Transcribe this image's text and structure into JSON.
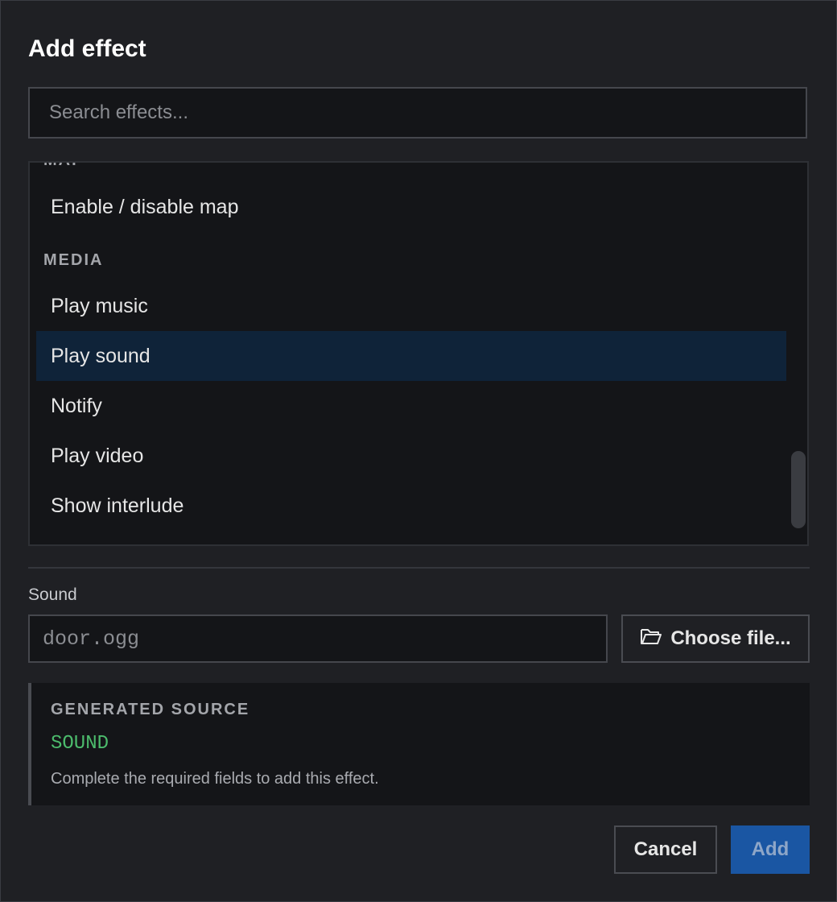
{
  "dialog": {
    "title": "Add effect",
    "search": {
      "placeholder": "Search effects..."
    }
  },
  "effect_list": {
    "groups": [
      {
        "header": "MAP",
        "items": [
          {
            "label": "Enable / disable map",
            "selected": false
          }
        ]
      },
      {
        "header": "MEDIA",
        "items": [
          {
            "label": "Play music",
            "selected": false
          },
          {
            "label": "Play sound",
            "selected": true
          },
          {
            "label": "Notify",
            "selected": false
          },
          {
            "label": "Play video",
            "selected": false
          },
          {
            "label": "Show interlude",
            "selected": false
          }
        ]
      }
    ]
  },
  "sound_field": {
    "label": "Sound",
    "placeholder": "door.ogg",
    "choose_button": "Choose file...",
    "choose_icon": "folder-open-icon"
  },
  "generated_source": {
    "heading": "GENERATED SOURCE",
    "code": "SOUND",
    "note": "Complete the required fields to add this effect."
  },
  "footer": {
    "cancel_label": "Cancel",
    "add_label": "Add"
  },
  "colors": {
    "selected_row": "#0f2339",
    "accent_button": "#1a56a3",
    "code_green": "#4cbb6c"
  }
}
